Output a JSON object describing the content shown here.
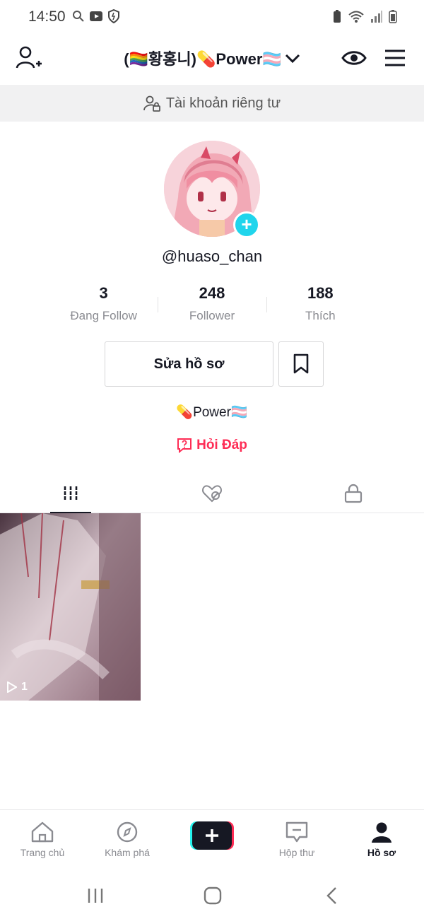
{
  "status_bar": {
    "time": "14:50"
  },
  "header": {
    "display_name": "(🏳️‍🌈황홍니)💊Power🏳️‍⚧️"
  },
  "private_banner": {
    "text": "Tài khoản riêng tư"
  },
  "profile": {
    "handle": "@huaso_chan",
    "bio": "💊Power🏳️‍⚧️",
    "qa_label": "Hỏi Đáp",
    "stats": [
      {
        "value": "3",
        "label": "Đang Follow"
      },
      {
        "value": "248",
        "label": "Follower"
      },
      {
        "value": "188",
        "label": "Thích"
      }
    ],
    "edit_button": "Sửa hồ sơ"
  },
  "videos": [
    {
      "views": "1"
    }
  ],
  "bottom_nav": {
    "items": [
      {
        "label": "Trang chủ",
        "icon": "home-icon"
      },
      {
        "label": "Khám phá",
        "icon": "compass-icon"
      },
      {
        "label": "",
        "icon": "create-plus-icon"
      },
      {
        "label": "Hộp thư",
        "icon": "inbox-icon"
      },
      {
        "label": "Hồ sơ",
        "icon": "profile-icon"
      }
    ]
  },
  "colors": {
    "accent": "#fe2c55",
    "cyan": "#20d5ec",
    "text": "#161823",
    "muted": "#8a8b91",
    "banner_bg": "#f1f1f2"
  }
}
